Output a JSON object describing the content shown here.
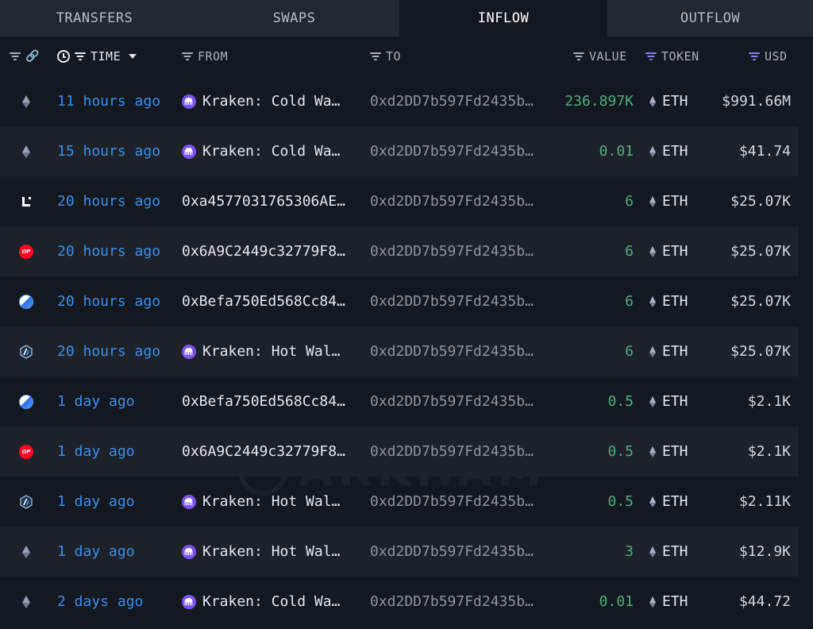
{
  "tabs": [
    {
      "label": "TRANSFERS",
      "active": false
    },
    {
      "label": "SWAPS",
      "active": false
    },
    {
      "label": "INFLOW",
      "active": true
    },
    {
      "label": "OUTFLOW",
      "active": false
    }
  ],
  "columns": {
    "time": "TIME",
    "from": "FROM",
    "to": "TO",
    "value": "VALUE",
    "token": "TOKEN",
    "usd": "USD"
  },
  "watermark": "ARKHAM",
  "rows": [
    {
      "chain": "ethereum",
      "time": "11 hours ago",
      "from": "Kraken: Cold Wa…",
      "from_entity": "kraken",
      "to": "0xd2DD7b597Fd2435b…",
      "value": "236.897K",
      "token": "ETH",
      "usd": "$991.66M"
    },
    {
      "chain": "ethereum",
      "time": "15 hours ago",
      "from": "Kraken: Cold Wa…",
      "from_entity": "kraken",
      "to": "0xd2DD7b597Fd2435b…",
      "value": "0.01",
      "token": "ETH",
      "usd": "$41.74"
    },
    {
      "chain": "linea",
      "time": "20 hours ago",
      "from": "0xa4577031765306AE…",
      "from_entity": "",
      "to": "0xd2DD7b597Fd2435b…",
      "value": "6",
      "token": "ETH",
      "usd": "$25.07K"
    },
    {
      "chain": "optimism",
      "time": "20 hours ago",
      "from": "0x6A9C2449c32779F8…",
      "from_entity": "",
      "to": "0xd2DD7b597Fd2435b…",
      "value": "6",
      "token": "ETH",
      "usd": "$25.07K"
    },
    {
      "chain": "base",
      "time": "20 hours ago",
      "from": "0xBefa750Ed568Cc84…",
      "from_entity": "",
      "to": "0xd2DD7b597Fd2435b…",
      "value": "6",
      "token": "ETH",
      "usd": "$25.07K"
    },
    {
      "chain": "arbitrum",
      "time": "20 hours ago",
      "from": "Kraken: Hot Wal…",
      "from_entity": "kraken",
      "to": "0xd2DD7b597Fd2435b…",
      "value": "6",
      "token": "ETH",
      "usd": "$25.07K"
    },
    {
      "chain": "base",
      "time": "1 day ago",
      "from": "0xBefa750Ed568Cc84…",
      "from_entity": "",
      "to": "0xd2DD7b597Fd2435b…",
      "value": "0.5",
      "token": "ETH",
      "usd": "$2.1K"
    },
    {
      "chain": "optimism",
      "time": "1 day ago",
      "from": "0x6A9C2449c32779F8…",
      "from_entity": "",
      "to": "0xd2DD7b597Fd2435b…",
      "value": "0.5",
      "token": "ETH",
      "usd": "$2.1K"
    },
    {
      "chain": "arbitrum",
      "time": "1 day ago",
      "from": "Kraken: Hot Wal…",
      "from_entity": "kraken",
      "to": "0xd2DD7b597Fd2435b…",
      "value": "0.5",
      "token": "ETH",
      "usd": "$2.11K"
    },
    {
      "chain": "ethereum",
      "time": "1 day ago",
      "from": "Kraken: Hot Wal…",
      "from_entity": "kraken",
      "to": "0xd2DD7b597Fd2435b…",
      "value": "3",
      "token": "ETH",
      "usd": "$12.9K"
    },
    {
      "chain": "ethereum",
      "time": "2 days ago",
      "from": "Kraken: Cold Wa…",
      "from_entity": "kraken",
      "to": "0xd2DD7b597Fd2435b…",
      "value": "0.01",
      "token": "ETH",
      "usd": "$44.72"
    }
  ],
  "icons": {
    "ethereum": "ethereum-chain-icon",
    "linea": "linea-chain-icon",
    "optimism": "optimism-chain-icon",
    "base": "base-chain-icon",
    "arbitrum": "arbitrum-chain-icon",
    "kraken": "kraken-entity-icon",
    "optimism_text": "OP"
  },
  "colors": {
    "time_link": "#3b8fe8",
    "value_green": "#4fae79",
    "kraken_purple": "#7a52f4",
    "filter_purple": "#8b7cf6"
  }
}
